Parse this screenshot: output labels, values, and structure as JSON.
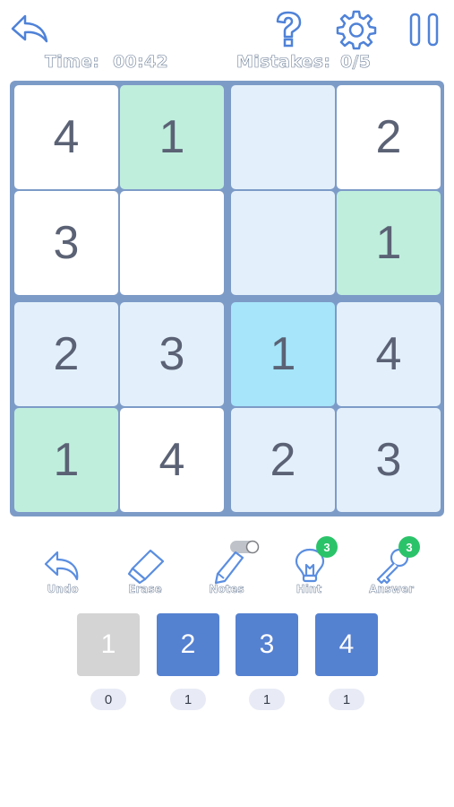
{
  "header": {
    "icons": [
      "back-arrow-icon",
      "help-question-icon",
      "settings-gear-icon",
      "pause-icon"
    ],
    "time_label": "Time:",
    "time_value": "00:42",
    "mistakes_label": "Mistakes:",
    "mistakes_value": "0/5"
  },
  "board": {
    "size": 4,
    "cells": [
      [
        {
          "v": "4",
          "bg": "white"
        },
        {
          "v": "1",
          "bg": "green"
        },
        {
          "v": "",
          "bg": "light"
        },
        {
          "v": "2",
          "bg": "white"
        }
      ],
      [
        {
          "v": "3",
          "bg": "white"
        },
        {
          "v": "",
          "bg": "white"
        },
        {
          "v": "",
          "bg": "light"
        },
        {
          "v": "1",
          "bg": "green"
        }
      ],
      [
        {
          "v": "2",
          "bg": "light"
        },
        {
          "v": "3",
          "bg": "light"
        },
        {
          "v": "1",
          "bg": "selected"
        },
        {
          "v": "4",
          "bg": "light"
        }
      ],
      [
        {
          "v": "1",
          "bg": "green"
        },
        {
          "v": "4",
          "bg": "white"
        },
        {
          "v": "2",
          "bg": "light"
        },
        {
          "v": "3",
          "bg": "light"
        }
      ]
    ]
  },
  "tools": {
    "undo_label": "Undo",
    "erase_label": "Erase",
    "notes_label": "Notes",
    "hint_label": "Hint",
    "hint_count": "3",
    "answer_label": "Answer",
    "answer_count": "3"
  },
  "numpad": {
    "keys": [
      {
        "label": "1",
        "count": "0",
        "disabled": true
      },
      {
        "label": "2",
        "count": "1",
        "disabled": false
      },
      {
        "label": "3",
        "count": "1",
        "disabled": false
      },
      {
        "label": "4",
        "count": "1",
        "disabled": false
      }
    ]
  },
  "colors": {
    "board_border": "#7d9bc7",
    "cell_white": "#ffffff",
    "cell_light": "#e3f0fb",
    "cell_green": "#bfeedd",
    "cell_selected": "#a6e5fa",
    "key_active": "#5581d1",
    "key_disabled": "#d4d4d4",
    "badge": "#2bc36a",
    "icon_blue": "#4f82d8"
  }
}
